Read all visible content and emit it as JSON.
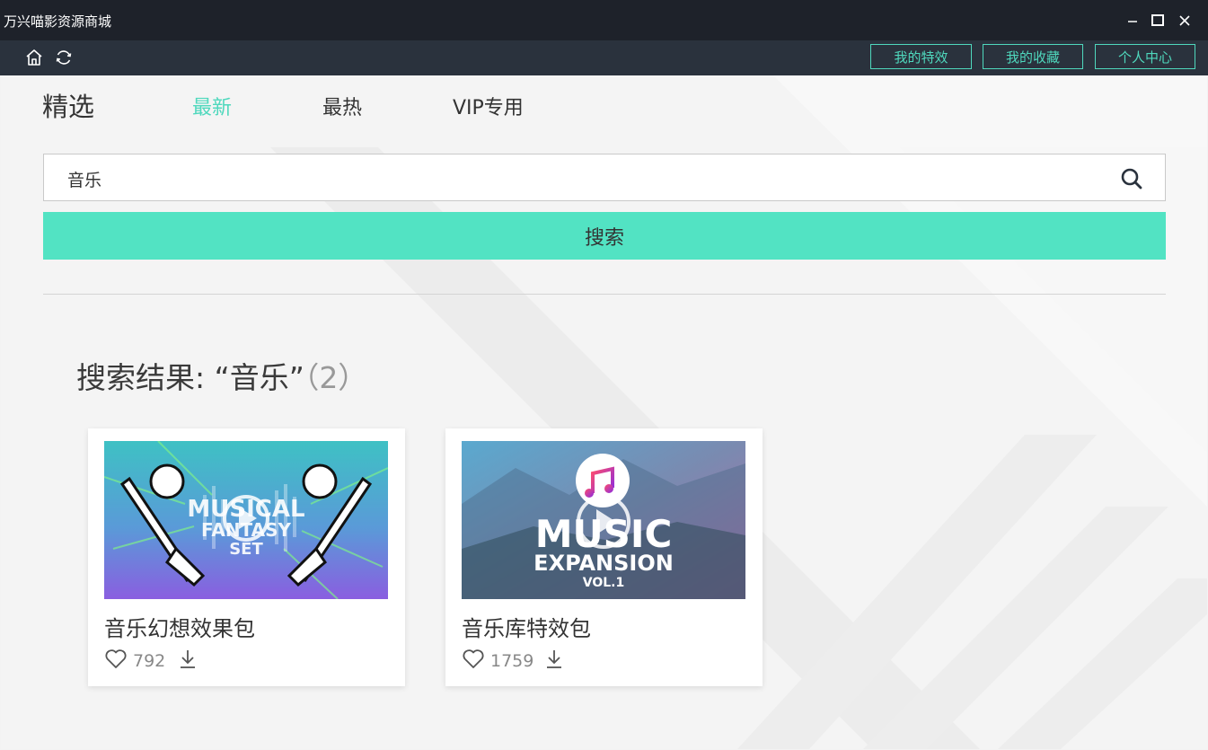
{
  "window": {
    "title": "万兴喵影资源商城"
  },
  "toolbar": {
    "home_icon": "home-icon",
    "refresh_icon": "refresh-icon",
    "buttons": [
      "我的特效",
      "我的收藏",
      "个人中心"
    ]
  },
  "nav": {
    "section_title": "精选",
    "tabs": [
      {
        "label": "最新",
        "active": true
      },
      {
        "label": "最热",
        "active": false
      },
      {
        "label": "VIP专用",
        "active": false
      }
    ]
  },
  "search": {
    "value": "音乐",
    "button_label": "搜索"
  },
  "results": {
    "heading": "搜索结果: “音乐”",
    "count": "（2）",
    "items": [
      {
        "name": "音乐幻想效果包",
        "likes": "792",
        "thumb_text": [
          "MUSICAL",
          "FANTASY",
          "SET"
        ]
      },
      {
        "name": "音乐库特效包",
        "likes": "1759",
        "thumb_text": [
          "MUSIC",
          "EXPANSION",
          "VOL.1"
        ]
      }
    ]
  },
  "colors": {
    "accent": "#4fd8bd",
    "search_button": "#52e3c3",
    "titlebar": "#1e222a",
    "toolbar": "#2a323d"
  }
}
